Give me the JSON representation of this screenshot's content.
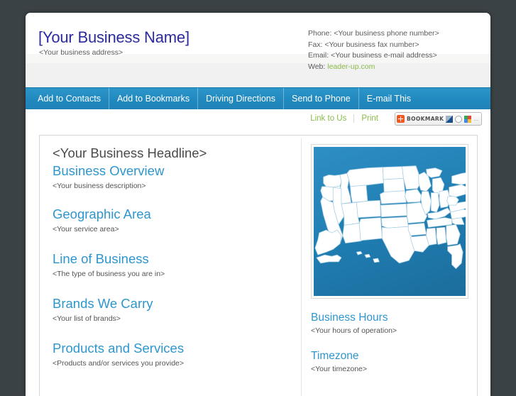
{
  "business": {
    "name": "[Your Business Name]",
    "address": "<Your business address>"
  },
  "contact": {
    "phone": "Phone: <Your business phone number>",
    "fax": "Fax: <Your business fax number>",
    "email": "Email: <Your business e-mail address>",
    "web_label": "Web: ",
    "web_url_text": "leader-up.com"
  },
  "nav": {
    "items": [
      {
        "label": "Add to Contacts"
      },
      {
        "label": "Add to Bookmarks"
      },
      {
        "label": "Driving Directions"
      },
      {
        "label": "Send to Phone"
      },
      {
        "label": "E-mail This"
      }
    ]
  },
  "utility": {
    "link_to_us": "Link to Us",
    "print": "Print",
    "bookmark_label": "BOOKMARK",
    "bookmark_more": "..."
  },
  "main": {
    "headline": "<Your Business Headline>",
    "sections": [
      {
        "title": "Business Overview",
        "body": "<Your business description>"
      },
      {
        "title": "Geographic Area",
        "body": "<Your service area>"
      },
      {
        "title": "Line of Business",
        "body": "<The type of business you are in>"
      },
      {
        "title": "Brands We Carry",
        "body": "<Your list of brands>"
      },
      {
        "title": "Products and Services",
        "body": "<Products and/or services you provide>"
      }
    ]
  },
  "sidebar": {
    "map_alt": "united-states-map",
    "sections": [
      {
        "title": "Business Hours",
        "body": "<Your hours of operation>"
      },
      {
        "title": "Timezone",
        "body": "<Your timezone>"
      }
    ]
  },
  "colors": {
    "page_background": "#3b4245",
    "nav_blue": "#2189bf",
    "heading_blue": "#2e96ce",
    "link_green": "#8cba4a",
    "business_name_navy": "#2b2b9e",
    "map_blue": "#1f7cb0",
    "bookmark_orange": "#f05a22"
  }
}
